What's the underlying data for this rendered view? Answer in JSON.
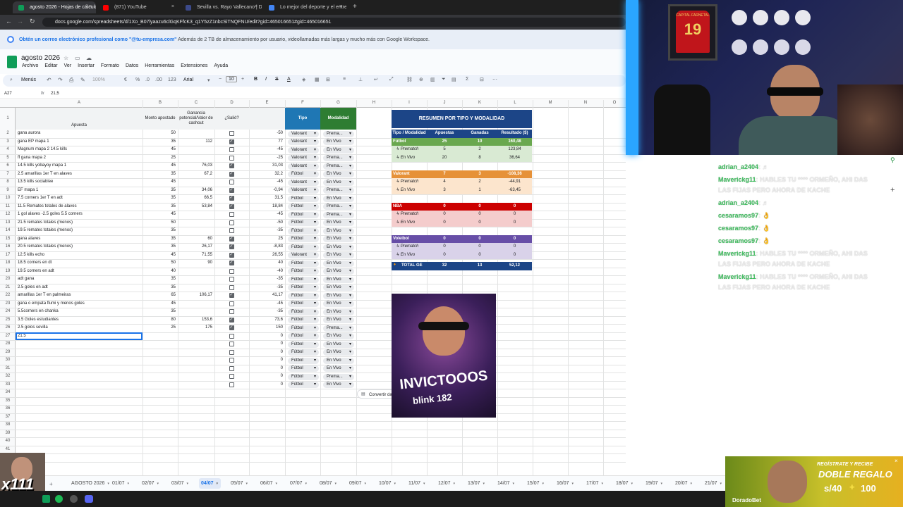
{
  "browser": {
    "tabs": [
      {
        "label": "agosto 2026 - Hojas de cálculo",
        "active": true,
        "favicon_color": "#0f9d58"
      },
      {
        "label": "(871) YouTube",
        "active": false,
        "favicon_color": "#ff0000"
      },
      {
        "label": "Sevilla vs. Rayo Vallecano | Dire",
        "active": false,
        "favicon_color": "#3c4a8a"
      },
      {
        "label": "Lo mejor del deporte y el entre",
        "active": false,
        "favicon_color": "#4285f4"
      }
    ],
    "url": "docs.google.com/spreadsheets/d/1Xo_B07lyaazu6clGqKFfcK3_q1Y5zZ1nbcSiTNQFNU/edit?gid=465016651#gid=465016651",
    "close_glyph": "×",
    "new_tab_glyph": "+"
  },
  "banner": {
    "lead": "Obtén un correo electrónico profesional como ",
    "highlight": "\"@tu-empresa.com\"",
    "rest": " Además de 2 TB de almacenamiento por usuario, videollamadas más largas y mucho más con Google Workspace."
  },
  "doc": {
    "title": "agosto 2026",
    "menu": [
      "Archivo",
      "Editar",
      "Ver",
      "Insertar",
      "Formato",
      "Datos",
      "Herramientas",
      "Extensiones",
      "Ayuda"
    ]
  },
  "toolbar": {
    "menus_label": "Menús",
    "zoom": "100%",
    "currency": "€",
    "percent": "%",
    "dec_less": ".0",
    "dec_more": ".00",
    "number_format": "123",
    "font": "Arial",
    "font_size": "10",
    "bold": "B",
    "italic": "I",
    "strike": "S",
    "text_color": "A",
    "sum": "Σ"
  },
  "formula_bar": {
    "cell_ref": "A27",
    "fx": "fx",
    "value": "21,5"
  },
  "columns": [
    "A",
    "B",
    "C",
    "D",
    "E",
    "F",
    "G",
    "H",
    "I",
    "J",
    "K",
    "L",
    "M",
    "N",
    "O"
  ],
  "headers": {
    "apuesta": "Apuesta",
    "monto": "Monto apostado",
    "ganancia": "Ganancia potencial/Valor de cashout",
    "salio": "¿Salió?",
    "tipo": "Tipo",
    "modalidad": "Modalidad"
  },
  "rows": [
    {
      "n": "2",
      "a": "gana aurora",
      "b": "50",
      "c": "",
      "d": false,
      "e": "-50",
      "f": "Valorant",
      "g": "Prema..."
    },
    {
      "n": "3",
      "a": "gana EP mapa 1",
      "b": "35",
      "c": "112",
      "d": true,
      "e": "77",
      "f": "Valorant",
      "g": "En Vivo"
    },
    {
      "n": "4",
      "a": "Magnum mapa 2 14.5 kills",
      "b": "45",
      "c": "",
      "d": false,
      "e": "-45",
      "f": "Valorant",
      "g": "En Vivo"
    },
    {
      "n": "5",
      "a": "ff gana mapa 2",
      "b": "25",
      "c": "",
      "d": false,
      "e": "-25",
      "f": "Valorant",
      "g": "Prema..."
    },
    {
      "n": "6",
      "a": "14.5 kills yobayoy mapa 1",
      "b": "45",
      "c": "76,03",
      "d": true,
      "e": "31,03",
      "f": "Valorant",
      "g": "Prema..."
    },
    {
      "n": "7",
      "a": "2.5 amarillas 1er T en alaves",
      "b": "35",
      "c": "67,2",
      "d": true,
      "e": "32,2",
      "f": "Fútbol",
      "g": "En Vivo"
    },
    {
      "n": "8",
      "a": "13.5 kills sociablee",
      "b": "45",
      "c": "",
      "d": false,
      "e": "-45",
      "f": "Valorant",
      "g": "En Vivo"
    },
    {
      "n": "9",
      "a": "EF mapa 1",
      "b": "35",
      "c": "34,06",
      "d": true,
      "e": "-0,94",
      "f": "Valorant",
      "g": "Prema..."
    },
    {
      "n": "10",
      "a": "7.5 corners 1er T en adt",
      "b": "35",
      "c": "66,5",
      "d": true,
      "e": "31,5",
      "f": "Fútbol",
      "g": "En Vivo"
    },
    {
      "n": "11",
      "a": "11.5 Remates totales de alaves",
      "b": "35",
      "c": "53,84",
      "d": true,
      "e": "18,84",
      "f": "Fútbol",
      "g": "Prema..."
    },
    {
      "n": "12",
      "a": "1 gol alaves -2.5 goles 5.5 corners",
      "b": "45",
      "c": "",
      "d": false,
      "e": "-45",
      "f": "Fútbol",
      "g": "Prema..."
    },
    {
      "n": "13",
      "a": "21.5 remates totales (menos)",
      "b": "50",
      "c": "",
      "d": false,
      "e": "-50",
      "f": "Fútbol",
      "g": "En Vivo"
    },
    {
      "n": "14",
      "a": "19.5 remates totales (menos)",
      "b": "35",
      "c": "",
      "d": false,
      "e": "-35",
      "f": "Fútbol",
      "g": "En Vivo"
    },
    {
      "n": "15",
      "a": "gana alaves",
      "b": "35",
      "c": "60",
      "d": true,
      "e": "25",
      "f": "Fútbol",
      "g": "En Vivo"
    },
    {
      "n": "16",
      "a": "20.5 remates totales (menos)",
      "b": "35",
      "c": "26,17",
      "d": true,
      "e": "-8,83",
      "f": "Fútbol",
      "g": "En Vivo"
    },
    {
      "n": "17",
      "a": "12.5 kills echo",
      "b": "45",
      "c": "71,55",
      "d": true,
      "e": "26,55",
      "f": "Valorant",
      "g": "En Vivo"
    },
    {
      "n": "18",
      "a": "18.5 corners en dt",
      "b": "50",
      "c": "90",
      "d": true,
      "e": "40",
      "f": "Fútbol",
      "g": "En Vivo"
    },
    {
      "n": "19",
      "a": "19.5 corners en adt",
      "b": "40",
      "c": "",
      "d": false,
      "e": "-40",
      "f": "Fútbol",
      "g": "En Vivo"
    },
    {
      "n": "20",
      "a": "adt gana",
      "b": "35",
      "c": "",
      "d": false,
      "e": "-35",
      "f": "Fútbol",
      "g": "En Vivo"
    },
    {
      "n": "21",
      "a": "2.5 goles en adt",
      "b": "35",
      "c": "",
      "d": false,
      "e": "-35",
      "f": "Fútbol",
      "g": "En Vivo"
    },
    {
      "n": "22",
      "a": "amarillas 1er T en palmeiras",
      "b": "65",
      "c": "106,17",
      "d": true,
      "e": "41,17",
      "f": "Fútbol",
      "g": "En Vivo"
    },
    {
      "n": "23",
      "a": "gana o empata flumi y menos goles",
      "b": "45",
      "c": "",
      "d": false,
      "e": "-45",
      "f": "Fútbol",
      "g": "En Vivo"
    },
    {
      "n": "24",
      "a": "5.5corners  en chanka",
      "b": "35",
      "c": "",
      "d": false,
      "e": "-35",
      "f": "Fútbol",
      "g": "En Vivo"
    },
    {
      "n": "25",
      "a": "3.5 Goles estudiantes",
      "b": "80",
      "c": "153,6",
      "d": true,
      "e": "73,6",
      "f": "Fútbol",
      "g": "En Vivo"
    },
    {
      "n": "26",
      "a": "2.5 golos sevilla",
      "b": "25",
      "c": "175",
      "d": true,
      "e": "150",
      "f": "Fútbol",
      "g": "Prema..."
    },
    {
      "n": "27",
      "a": "21.5",
      "b": "",
      "c": "",
      "d": false,
      "e": "0",
      "f": "Fútbol",
      "g": "En Vivo"
    },
    {
      "n": "28",
      "a": "",
      "b": "",
      "c": "",
      "d": false,
      "e": "0",
      "f": "Fútbol",
      "g": "En Vivo"
    },
    {
      "n": "29",
      "a": "",
      "b": "",
      "c": "",
      "d": false,
      "e": "0",
      "f": "Fútbol",
      "g": "En Vivo"
    },
    {
      "n": "30",
      "a": "",
      "b": "",
      "c": "",
      "d": false,
      "e": "0",
      "f": "Fútbol",
      "g": "En Vivo"
    },
    {
      "n": "31",
      "a": "",
      "b": "",
      "c": "",
      "d": false,
      "e": "0",
      "f": "Fútbol",
      "g": "En Vivo"
    },
    {
      "n": "32",
      "a": "",
      "b": "",
      "c": "",
      "d": false,
      "e": "0",
      "f": "Fútbol",
      "g": "Prema..."
    },
    {
      "n": "33",
      "a": "",
      "b": "",
      "c": "",
      "d": false,
      "e": "0",
      "f": "Fútbol",
      "g": "En Vivo"
    }
  ],
  "extra_row_numbers": [
    "34",
    "35",
    "36",
    "37",
    "38",
    "39",
    "40",
    "41",
    "42"
  ],
  "summary": {
    "title": "RESUMEN POR TIPO Y MODALIDAD",
    "headers": [
      "Tipo / Modalidad",
      "Apuestas",
      "Ganadas",
      "Resultado ($)"
    ],
    "groups": [
      {
        "name": "Fútbol",
        "apuestas": "25",
        "ganadas": "10",
        "resultado": "160,48",
        "head_color": "#6aa84f",
        "sub_color": "#d9ead3",
        "subs": [
          {
            "name": "↳ Prematch",
            "apuestas": "5",
            "ganadas": "2",
            "resultado": "123,84"
          },
          {
            "name": "↳ En Vivo",
            "apuestas": "20",
            "ganadas": "8",
            "resultado": "36,64"
          }
        ]
      },
      {
        "name": "Valorant",
        "apuestas": "7",
        "ganadas": "3",
        "resultado": "-108,36",
        "head_color": "#e69138",
        "sub_color": "#fce5cd",
        "subs": [
          {
            "name": "↳ Prematch",
            "apuestas": "4",
            "ganadas": "2",
            "resultado": "-44,91"
          },
          {
            "name": "↳ En Vivo",
            "apuestas": "3",
            "ganadas": "1",
            "resultado": "-63,45"
          }
        ]
      },
      {
        "name": "NBA",
        "apuestas": "0",
        "ganadas": "0",
        "resultado": "0",
        "head_color": "#cc0000",
        "sub_color": "#f4cccc",
        "subs": [
          {
            "name": "↳ Prematch",
            "apuestas": "0",
            "ganadas": "0",
            "resultado": "0"
          },
          {
            "name": "↳ En Vivo",
            "apuestas": "0",
            "ganadas": "0",
            "resultado": "0"
          }
        ]
      },
      {
        "name": "Voleibol",
        "apuestas": "0",
        "ganadas": "0",
        "resultado": "0",
        "head_color": "#674ea7",
        "sub_color": "#d9d2e9",
        "subs": [
          {
            "name": "↳ Prematch",
            "apuestas": "0",
            "ganadas": "0",
            "resultado": "0"
          },
          {
            "name": "↳ En Vivo",
            "apuestas": "0",
            "ganadas": "0",
            "resultado": "0"
          }
        ]
      }
    ],
    "total": {
      "name": "TOTAL GE",
      "apuestas": "32",
      "ganadas": "13",
      "resultado": "52,12"
    }
  },
  "convert_chip": "Convertir datos en una tabla",
  "image_caption": {
    "line1": "INVICTOOOS",
    "line2": "blink 182"
  },
  "sheet_tabs": [
    "AGOSTO 2026",
    "01/07",
    "02/07",
    "03/07",
    "04/07",
    "05/07",
    "06/07",
    "07/07",
    "08/07",
    "09/07",
    "10/07",
    "11/07",
    "12/07",
    "13/07",
    "14/07",
    "15/07",
    "16/07",
    "17/07",
    "18/07",
    "19/07",
    "20/07",
    "21/07",
    "22/07"
  ],
  "active_sheet": "04/07",
  "stream": {
    "jersey_name": "CAPITAL FARNETAL",
    "jersey_number": "19",
    "chat": [
      {
        "user": "adrian_a2404",
        "text": ": ♬"
      },
      {
        "user": "Maverickg11",
        "text": ": HABLES TU **** ORMEÑO, AHI DAS"
      },
      {
        "user": "",
        "text": "LAS FIJAS PERO AHORA DE KACHE"
      },
      {
        "user": "adrian_a2404",
        "text": ": ♬"
      },
      {
        "user": "cesaramos97",
        "text": ": 👌"
      },
      {
        "user": "cesaramos97",
        "text": ": 👌"
      },
      {
        "user": "cesaramos97",
        "text": ": 👌"
      },
      {
        "user": "Maverickg11",
        "text": ": HABLES TU **** ORMEÑO, AHI DAS"
      },
      {
        "user": "",
        "text": "LAS FIJAS PERO AHORA DE KACHE"
      },
      {
        "user": "Maverickg11",
        "text": ": HABLES TU **** ORMEÑO, AHI DAS"
      },
      {
        "user": "",
        "text": "LAS FIJAS PERO AHORA DE KACHE"
      }
    ],
    "ad": {
      "line1": "REGÍSTRATE Y RECIBE",
      "line2": "DOBLE REGALO",
      "amount1": "s/40",
      "amount2": "100",
      "brand": "DoradoBet"
    },
    "overlay_text": "x111"
  }
}
